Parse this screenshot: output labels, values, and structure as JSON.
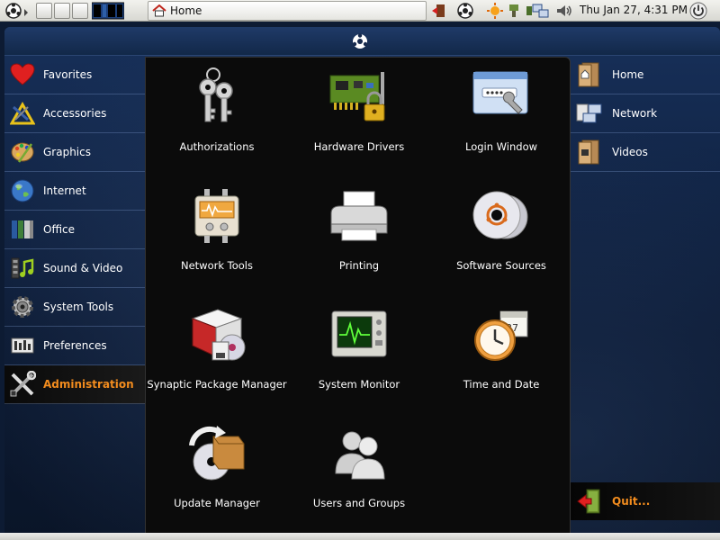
{
  "top_panel": {
    "task_home": "Home",
    "clock": "Thu Jan 27,  4:31 PM"
  },
  "categories": [
    {
      "label": "Favorites",
      "icon": "heart-icon"
    },
    {
      "label": "Accessories",
      "icon": "accessories-icon"
    },
    {
      "label": "Graphics",
      "icon": "palette-icon"
    },
    {
      "label": "Internet",
      "icon": "globe-icon"
    },
    {
      "label": "Office",
      "icon": "office-icon"
    },
    {
      "label": "Sound & Video",
      "icon": "sound-video-icon"
    },
    {
      "label": "System Tools",
      "icon": "gear-icon"
    },
    {
      "label": "Preferences",
      "icon": "preferences-icon"
    },
    {
      "label": "Administration",
      "icon": "tools-icon",
      "active": true
    }
  ],
  "apps": [
    {
      "label": "Authorizations",
      "icon": "keys-icon"
    },
    {
      "label": "Hardware Drivers",
      "icon": "circuit-board-icon"
    },
    {
      "label": "Login Window",
      "icon": "login-window-icon"
    },
    {
      "label": "Network Tools",
      "icon": "network-tools-icon"
    },
    {
      "label": "Printing",
      "icon": "printer-icon"
    },
    {
      "label": "Software Sources",
      "icon": "cd-icon"
    },
    {
      "label": "Synaptic Package Manager",
      "icon": "package-icon"
    },
    {
      "label": "System Monitor",
      "icon": "monitor-icon"
    },
    {
      "label": "Time and Date",
      "icon": "clock-icon"
    },
    {
      "label": "Update Manager",
      "icon": "update-icon"
    },
    {
      "label": "Users and Groups",
      "icon": "users-icon"
    }
  ],
  "places": [
    {
      "label": "Home",
      "icon": "home-folder-icon"
    },
    {
      "label": "Network",
      "icon": "network-icon"
    },
    {
      "label": "Videos",
      "icon": "videos-folder-icon"
    }
  ],
  "quit_label": "Quit...",
  "colors": {
    "accent": "#f28c1e",
    "menu_bg": "#0d1b33",
    "panel_bg": "#0b0b0b"
  }
}
